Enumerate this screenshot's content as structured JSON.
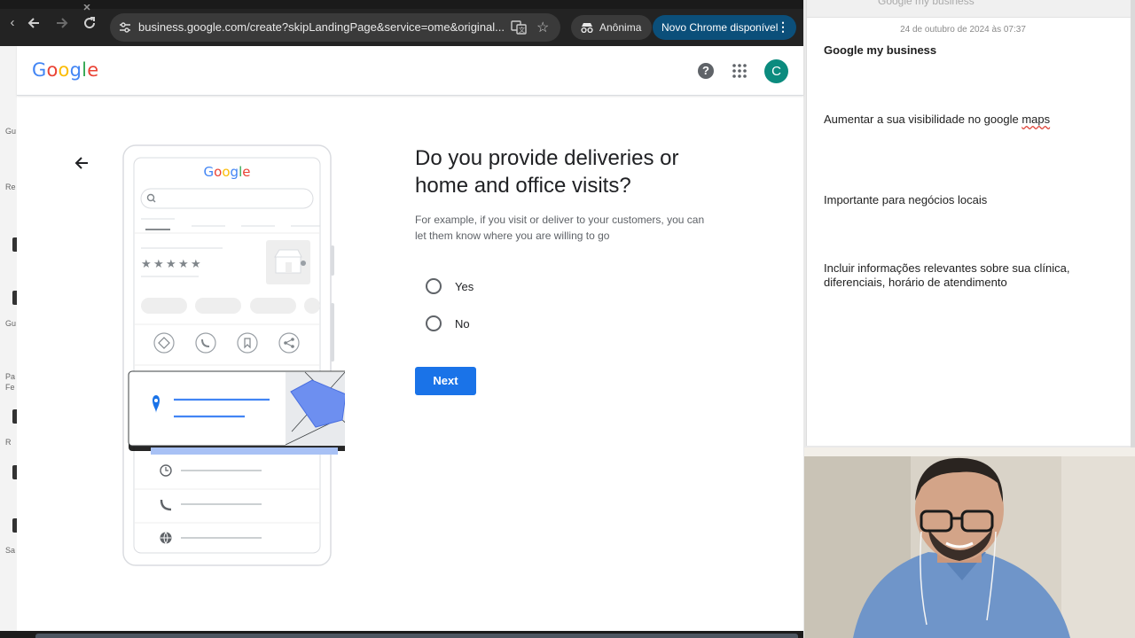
{
  "desktop": {
    "labels": [
      "Gu",
      "Re",
      "Gu",
      "Pa",
      "Fe",
      "R",
      "Sa"
    ]
  },
  "browser": {
    "url": "business.google.com/create?skipLandingPage&service=ome&original...",
    "incognito_label": "Anônima",
    "update_label": "Novo Chrome disponível"
  },
  "google": {
    "logo": [
      "G",
      "o",
      "o",
      "g",
      "l",
      "e"
    ],
    "logo_colors": [
      "#4285f4",
      "#ea4335",
      "#fbbc05",
      "#4285f4",
      "#34a853",
      "#ea4335"
    ],
    "avatar_letter": "C"
  },
  "illustration": {
    "logo_text": "Google"
  },
  "question": {
    "title": "Do you provide deliveries or home and office visits?",
    "description": "For example, if you visit or deliver to your customers, you can let them know where you are willing to go",
    "options": [
      "Yes",
      "No"
    ],
    "next_label": "Next"
  },
  "notes": {
    "window_title": "Google my business",
    "date": "24 de outubro de 2024 às 07:37",
    "heading": "Google my business",
    "line1_before": "Aumentar a sua visibilidade no google ",
    "line1_misspelled": "maps",
    "line2": "Importante para negócios locais",
    "line3": "Incluir informações relevantes sobre sua clínica, diferenciais, horário de atendimento"
  },
  "colors": {
    "accent": "#1a73e8",
    "avatar": "#0b8b7e",
    "update_badge": "#0b4f7a"
  }
}
